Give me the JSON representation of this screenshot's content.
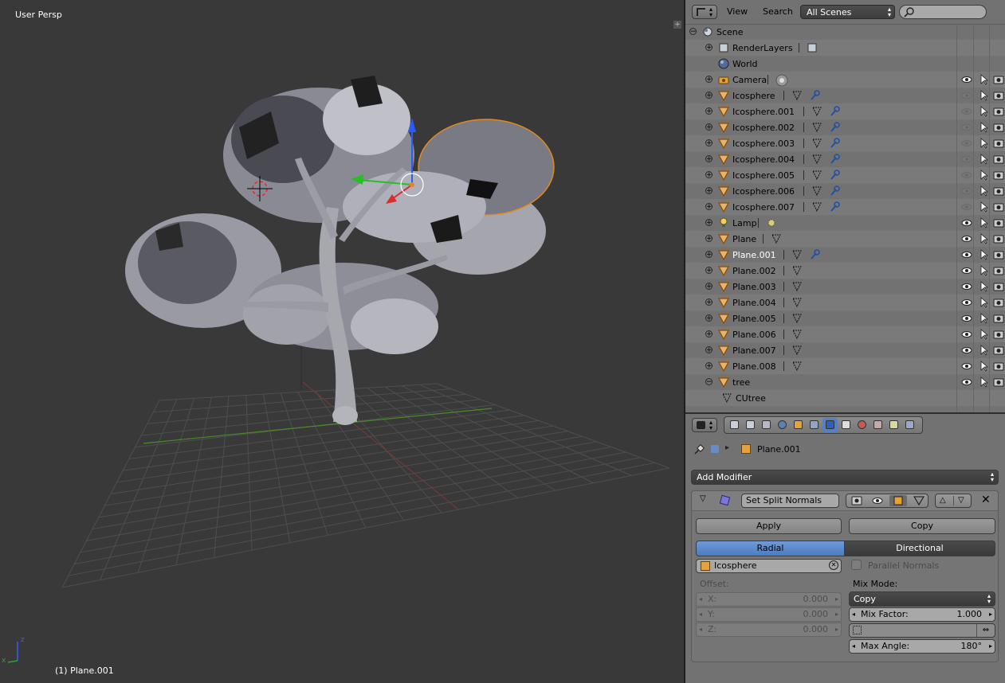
{
  "viewport": {
    "view_label": "User Persp",
    "object_label": "(1) Plane.001",
    "axis_x": "x",
    "axis_z": "z"
  },
  "outliner": {
    "menu_view": "View",
    "menu_search": "Search",
    "scene_selector": "All Scenes",
    "items": [
      {
        "name": "Scene",
        "icon": "scene-icon"
      },
      {
        "name": "RenderLayers",
        "icon": "renderlayers-icon"
      },
      {
        "name": "World",
        "icon": "world-icon"
      },
      {
        "name": "Camera",
        "icon": "camera-icon"
      },
      {
        "name": "Icosphere",
        "icon": "mesh-object-icon"
      },
      {
        "name": "Icosphere.001",
        "icon": "mesh-object-icon"
      },
      {
        "name": "Icosphere.002",
        "icon": "mesh-object-icon"
      },
      {
        "name": "Icosphere.003",
        "icon": "mesh-object-icon"
      },
      {
        "name": "Icosphere.004",
        "icon": "mesh-object-icon"
      },
      {
        "name": "Icosphere.005",
        "icon": "mesh-object-icon"
      },
      {
        "name": "Icosphere.006",
        "icon": "mesh-object-icon"
      },
      {
        "name": "Icosphere.007",
        "icon": "mesh-object-icon"
      },
      {
        "name": "Lamp",
        "icon": "lamp-icon"
      },
      {
        "name": "Plane",
        "icon": "mesh-object-icon"
      },
      {
        "name": "Plane.001",
        "icon": "mesh-object-icon"
      },
      {
        "name": "Plane.002",
        "icon": "mesh-object-icon"
      },
      {
        "name": "Plane.003",
        "icon": "mesh-object-icon"
      },
      {
        "name": "Plane.004",
        "icon": "mesh-object-icon"
      },
      {
        "name": "Plane.005",
        "icon": "mesh-object-icon"
      },
      {
        "name": "Plane.006",
        "icon": "mesh-object-icon"
      },
      {
        "name": "Plane.007",
        "icon": "mesh-object-icon"
      },
      {
        "name": "Plane.008",
        "icon": "mesh-object-icon"
      },
      {
        "name": "tree",
        "icon": "mesh-object-icon"
      },
      {
        "name": "CUtree",
        "icon": "mesh-data-icon"
      }
    ]
  },
  "properties": {
    "breadcrumb_object": "Plane.001",
    "add_modifier": "Add Modifier",
    "modifier": {
      "name": "Set Split Normals",
      "apply": "Apply",
      "copy": "Copy",
      "mode_radial": "Radial",
      "mode_directional": "Directional",
      "target": "Icosphere",
      "parallel_normals": "Parallel Normals",
      "offset_label": "Offset:",
      "x_label": "X:",
      "x_value": "0.000",
      "y_label": "Y:",
      "y_value": "0.000",
      "z_label": "Z:",
      "z_value": "0.000",
      "mix_mode_label": "Mix Mode:",
      "mix_mode_value": "Copy",
      "mix_factor_label": "Mix Factor:",
      "mix_factor_value": "1.000",
      "max_angle_label": "Max Angle:",
      "max_angle_value": "180°"
    }
  }
}
